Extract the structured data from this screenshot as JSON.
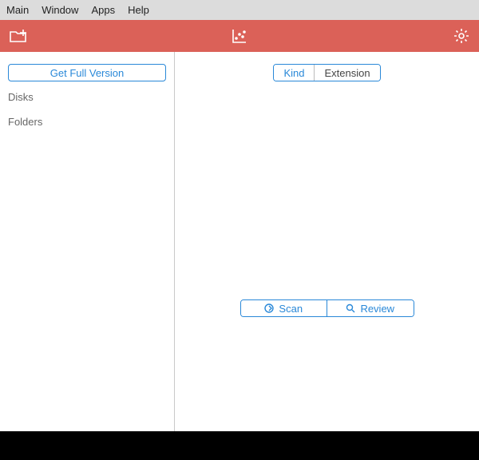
{
  "menubar": {
    "items": [
      "Main",
      "Window",
      "Apps",
      "Help"
    ]
  },
  "sidebar": {
    "cta_label": "Get Full Version",
    "items": [
      "Disks",
      "Folders"
    ]
  },
  "main": {
    "seg": {
      "active": "Kind",
      "other": "Extension"
    },
    "actions": {
      "scan": "Scan",
      "review": "Review"
    }
  },
  "colors": {
    "accent": "#db6158",
    "link": "#2988d8"
  }
}
